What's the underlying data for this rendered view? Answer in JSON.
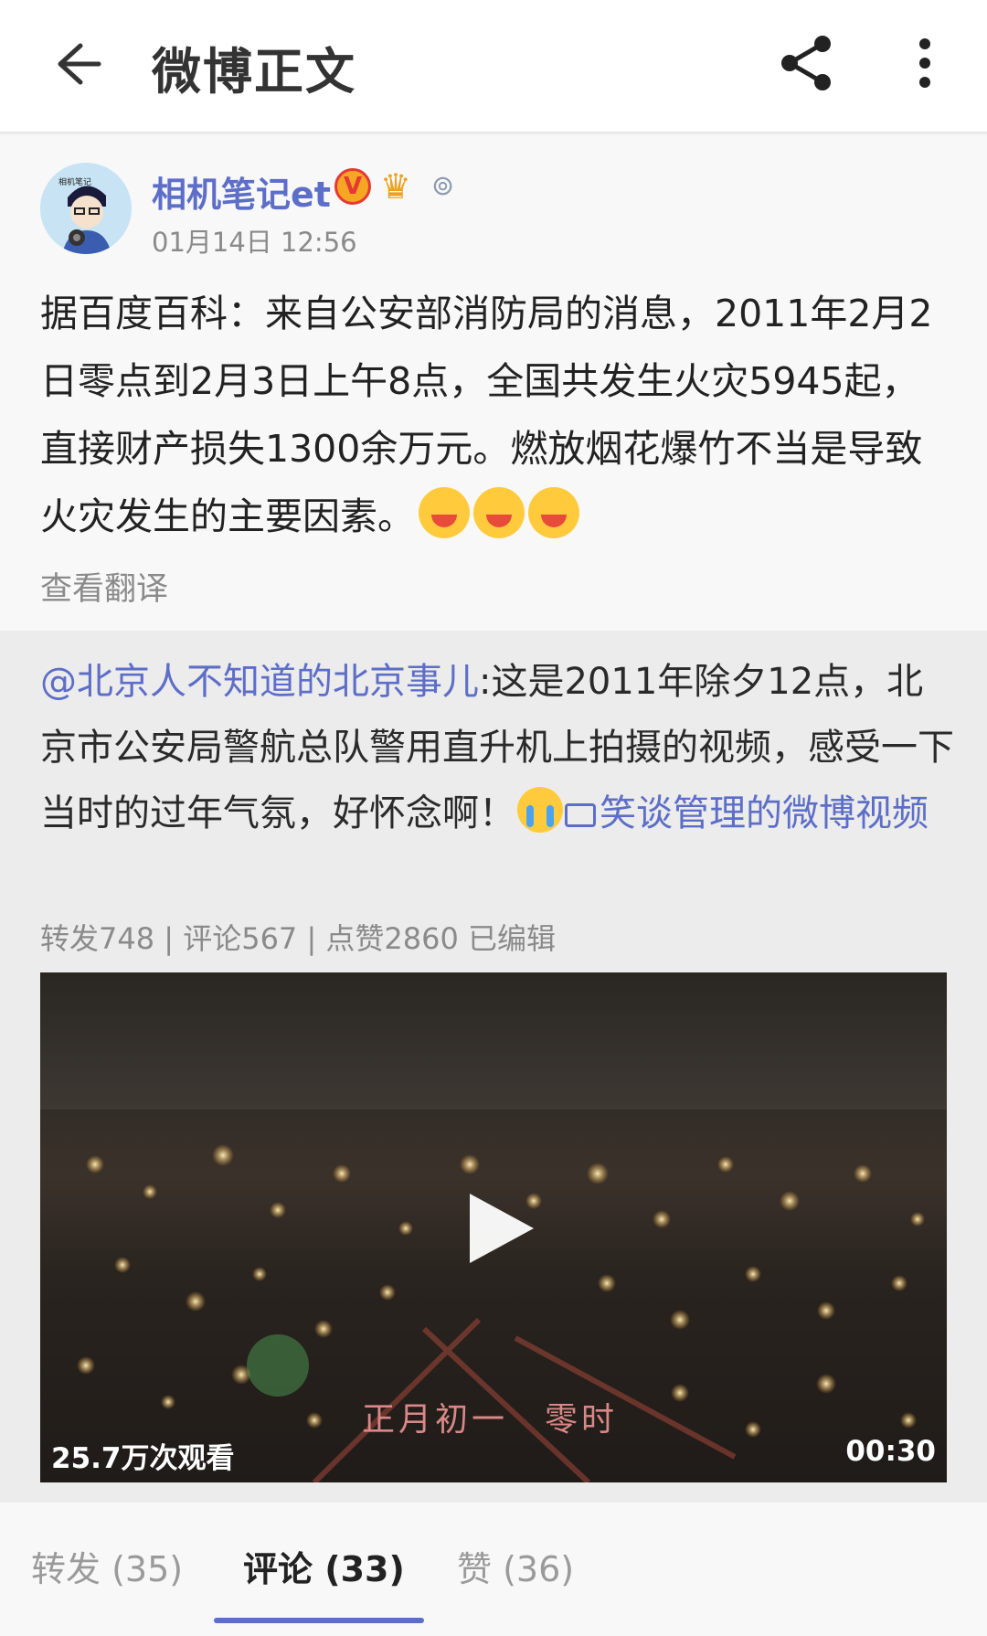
{
  "topbar": {
    "title": "微博正文",
    "back_icon": "arrow-left-icon",
    "share_icon": "share-icon",
    "more_icon": "more-vertical-icon"
  },
  "post": {
    "user_name": "相机笔记et",
    "time": "01月14日 12:56",
    "text": "据百度百科：来自公安部消防局的消息，2011年2月2日零点到2月3日上午8点，全国共发生火灾5945起，直接财产损失1300余万元。燃放烟花爆竹不当是导致火灾发生的主要因素。",
    "translate_label": "查看翻译",
    "avatar_text": "相机笔记"
  },
  "repost": {
    "mention": "@北京人不知道的北京事儿",
    "text": ":这是2011年除夕12点，北京市公安局警航总队警用直升机上拍摄的视频，感受一下当时的过年气氛，好怀念啊！",
    "video_link": "笑谈管理的微博视频",
    "stats": "转发748 | 评论567 | 点赞2860  已编辑"
  },
  "video": {
    "subtitle": "正月初一　零时",
    "views": "25.7万次观看",
    "duration": "00:30"
  },
  "tabs": [
    {
      "label": "转发 (35)"
    },
    {
      "label": "评论 (33)"
    },
    {
      "label": "赞 (36)"
    }
  ],
  "colors": {
    "accent": "#5d6ec8",
    "text": "#222222",
    "muted": "#8a8a8a"
  }
}
